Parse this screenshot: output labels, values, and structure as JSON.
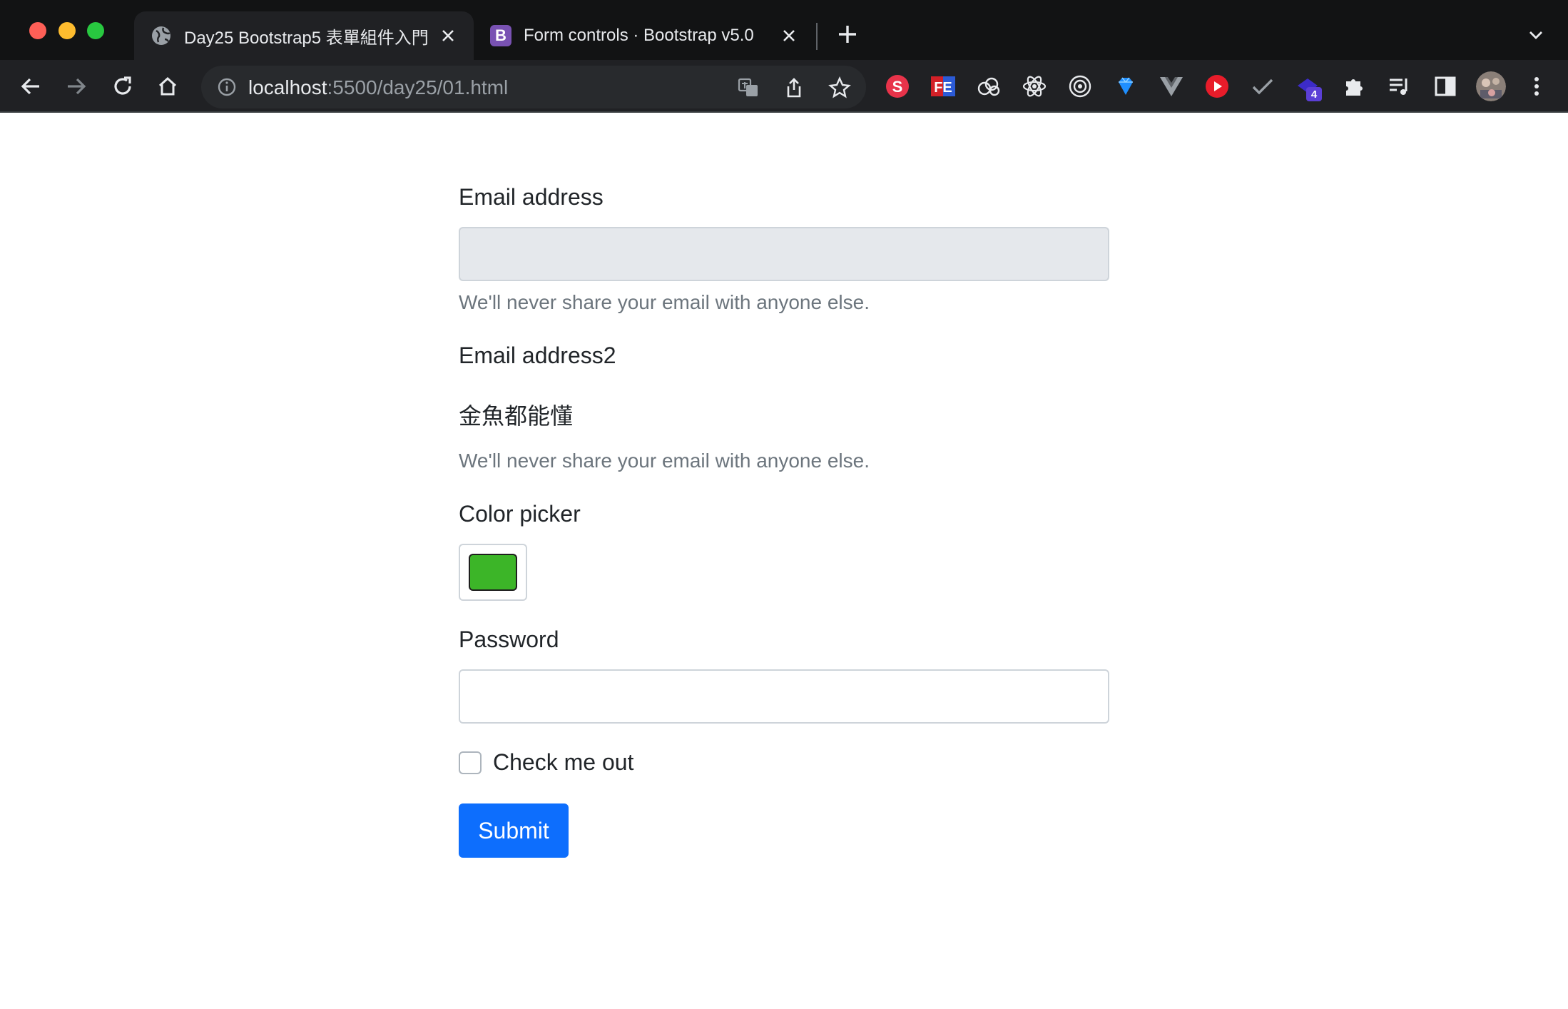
{
  "browser": {
    "tabs": [
      {
        "title": "Day25 Bootstrap5 表單組件入門",
        "favicon": "globe-icon",
        "active": true
      },
      {
        "title": "Form controls · Bootstrap v5.0",
        "favicon": "B",
        "active": false
      }
    ],
    "omnibox": {
      "host": "localhost",
      "path": ":5500/day25/01.html"
    },
    "extension_badge": "4"
  },
  "form": {
    "email_label": "Email address",
    "email_help": "We'll never share your email with anyone else.",
    "email2_label": "Email address2",
    "email2_value": "金魚都能懂",
    "email2_help": "We'll never share your email with anyone else.",
    "color_label": "Color picker",
    "color_value": "#3cb528",
    "password_label": "Password",
    "check_label": "Check me out",
    "submit_label": "Submit"
  },
  "colors": {
    "primary": "#0d6efd",
    "chrome_bg": "#202124",
    "tabstrip_bg": "#121314"
  }
}
